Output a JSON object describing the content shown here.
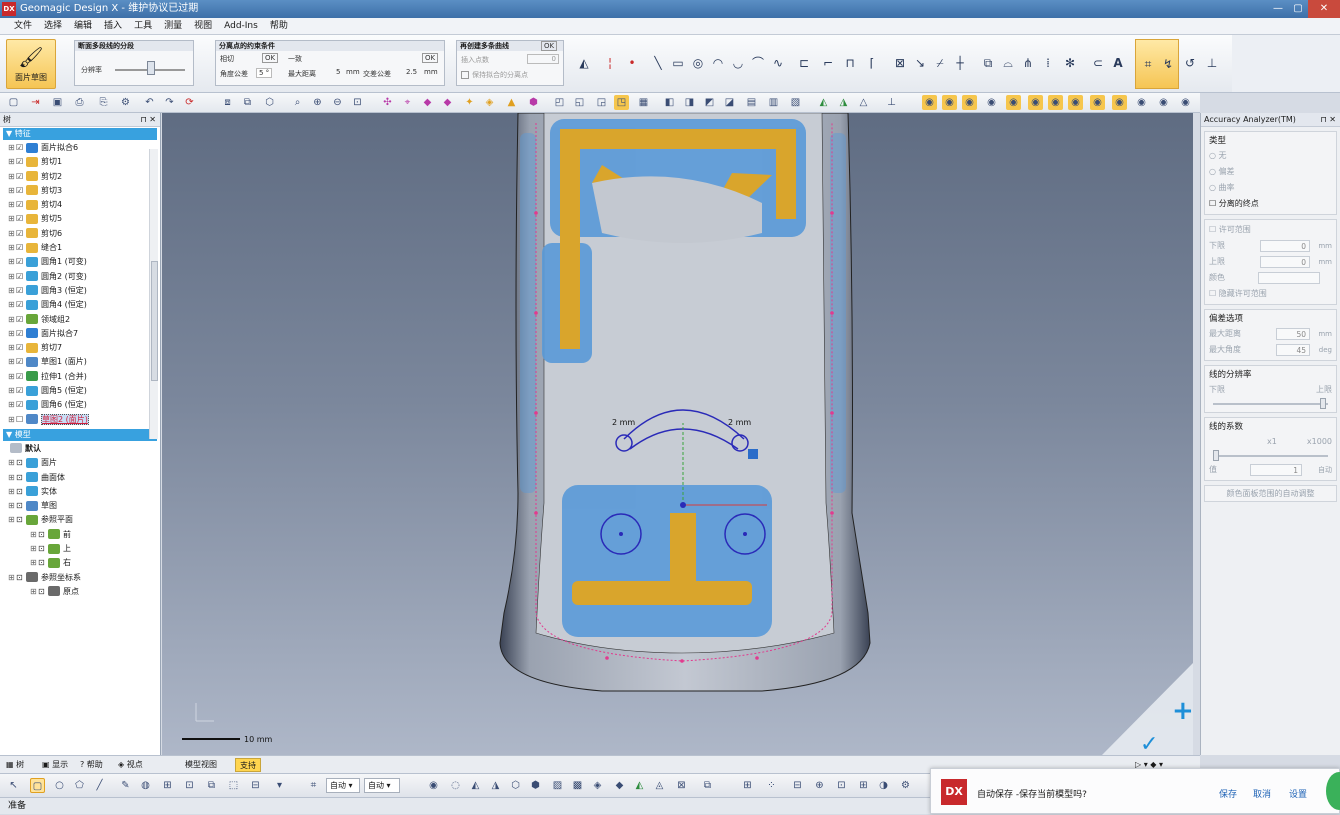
{
  "window": {
    "title": "Geomagic Design X - 维护协议已过期",
    "min": "—",
    "max": "▢",
    "close": "✕"
  },
  "menu": [
    "文件",
    "选择",
    "编辑",
    "插入",
    "工具",
    "测量",
    "视图",
    "Add-Ins",
    "帮助"
  ],
  "ribbon": {
    "big_button_label": "面片草图",
    "seg_panel": {
      "title": "断面多段线的分段",
      "slider_label": "分辨率"
    },
    "tol_panel": {
      "title": "分离点的约束条件",
      "angle_label": "角度公差",
      "angle_value": "5 °",
      "tangent": "相切",
      "ok1": "OK",
      "general": "一致",
      "ok2": "OK",
      "max_dist_label": "最大距离",
      "max_dist_value": "5",
      "mm": "mm",
      "cross_label": "交差公差",
      "cross_value": "2.5"
    },
    "resect_panel": {
      "title": "再创建多条曲线",
      "ok": "OK",
      "insert_label": "插入点数",
      "insert_value": "0",
      "keep_label": "保持拟合的分离点"
    }
  },
  "tree": {
    "pane_title": "树",
    "features_header": "特征",
    "features": [
      {
        "label": "面片拟合6"
      },
      {
        "label": "剪切1"
      },
      {
        "label": "剪切2"
      },
      {
        "label": "剪切3"
      },
      {
        "label": "剪切4"
      },
      {
        "label": "剪切5"
      },
      {
        "label": "剪切6"
      },
      {
        "label": "缝合1"
      },
      {
        "label": "圆角1 (可变)"
      },
      {
        "label": "圆角2 (可变)"
      },
      {
        "label": "圆角3 (恒定)"
      },
      {
        "label": "圆角4 (恒定)"
      },
      {
        "label": "领域组2"
      },
      {
        "label": "面片拟合7"
      },
      {
        "label": "剪切7"
      },
      {
        "label": "草图1 (面片)"
      },
      {
        "label": "拉伸1 (合并)"
      },
      {
        "label": "圆角5 (恒定)"
      },
      {
        "label": "圆角6 (恒定)"
      },
      {
        "label": "草图2 (面片)"
      }
    ],
    "model_header": "模型",
    "model": [
      {
        "label": "默认"
      },
      {
        "label": "面片"
      },
      {
        "label": "曲面体"
      },
      {
        "label": "实体"
      },
      {
        "label": "草图"
      },
      {
        "label": "参照平面"
      },
      {
        "label": "前"
      },
      {
        "label": "上"
      },
      {
        "label": "右"
      },
      {
        "label": "参照坐标系"
      },
      {
        "label": "原点"
      }
    ],
    "bottom_tabs": [
      "树",
      "显示",
      "帮助",
      "视点"
    ]
  },
  "viewport": {
    "dim1": "2 mm",
    "dim2": "2 mm",
    "scale": "10 mm"
  },
  "analyzer": {
    "title": "Accuracy Analyzer(TM)",
    "type_title": "类型",
    "types": [
      "无",
      "偏差",
      "曲率"
    ],
    "sep_endpoints": "分离的终点",
    "allow_range": "许可范围",
    "lower": "下限",
    "lower_val": "0",
    "upper": "上限",
    "upper_val": "0",
    "unit_mm": "mm",
    "color": "颜色",
    "hide_range": "隐藏许可范围",
    "dev_opt": "偏差选项",
    "max_dist": "最大距离",
    "max_dist_val": "50",
    "max_angle": "最大角度",
    "max_angle_val": "45",
    "unit_deg": "deg",
    "line_res": "线的分辨率",
    "res_low": "下限",
    "res_high": "上限",
    "line_factor": "线的系数",
    "x1": "x1",
    "x1000": "x1000",
    "value": "值",
    "value_val": "1",
    "auto": "自动",
    "auto_adjust": "颜色面板范围的自动调整"
  },
  "view_tabs": [
    "模型视图",
    "支持"
  ],
  "bottom_toolbar": {
    "combo1": "自动",
    "combo2": "自动"
  },
  "status": "准备",
  "autosave": {
    "logo": "DX",
    "message": "自动保存 -保存当前模型吗?",
    "save": "保存",
    "cancel": "取消",
    "settings": "设置"
  }
}
